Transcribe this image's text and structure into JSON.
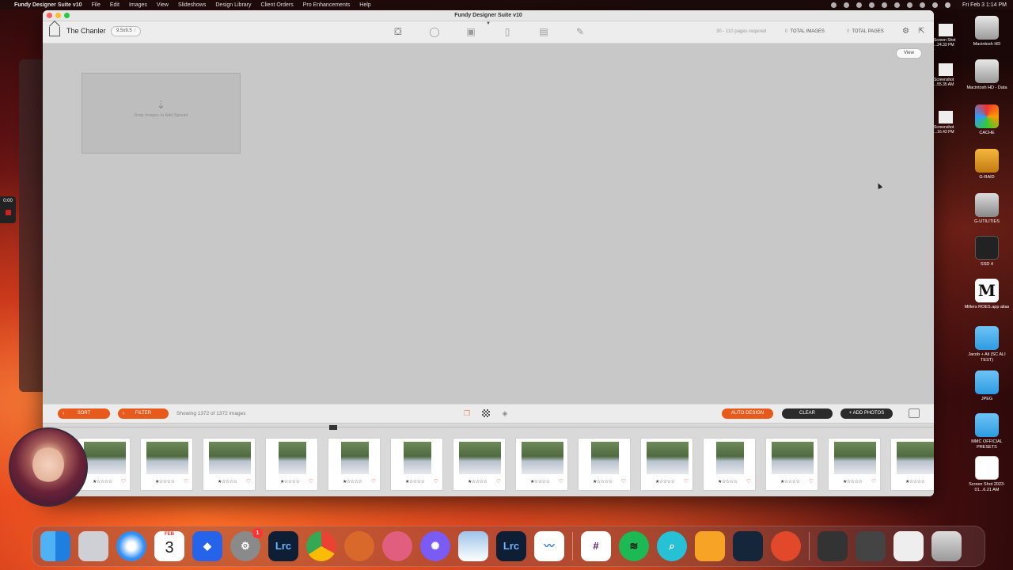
{
  "menubar": {
    "app_name": "Fundy Designer Suite v10",
    "items": [
      "File",
      "Edit",
      "Images",
      "View",
      "Slideshows",
      "Design Library",
      "Client Orders",
      "Pro Enhancements",
      "Help"
    ],
    "clock": "Fri Feb 3  1:14 PM"
  },
  "window": {
    "title": "Fundy Designer Suite v10"
  },
  "toolbar": {
    "album_name": "The Chanler",
    "size": "9.5x9.5",
    "pages_required": "30 - 110 pages required",
    "total_images_count": "0",
    "total_images_label": "TOTAL IMAGES",
    "total_pages_count": "0",
    "total_pages_label": "TOTAL PAGES",
    "mode_icons": [
      "album-design-icon",
      "proof-chat-icon",
      "wall-art-icon",
      "cards-icon",
      "slideshow-icon",
      "retouch-icon"
    ]
  },
  "canvas": {
    "view_label": "View",
    "drop_text": "Drop Images to Add Spread"
  },
  "bottombar": {
    "sort_label": "SORT",
    "filter_label": "FILTER",
    "showing_text": "Showing 1372 of 1372 images",
    "auto_design_label": "AUTO DESIGN",
    "clear_label": "CLEAR",
    "add_photos_label": "+ ADD PHOTOS",
    "colors": {
      "orange": "#e85a1c",
      "dark": "#2b2b2b"
    }
  },
  "filmstrip": {
    "thumbs": [
      {
        "orientation": "landscape",
        "rating": "★☆☆☆☆"
      },
      {
        "orientation": "landscape",
        "rating": "★☆☆☆☆"
      },
      {
        "orientation": "landscape",
        "rating": "★☆☆☆☆"
      },
      {
        "orientation": "portrait",
        "rating": "★☆☆☆☆"
      },
      {
        "orientation": "portrait",
        "rating": "★☆☆☆☆"
      },
      {
        "orientation": "portrait",
        "rating": "★☆☆☆☆"
      },
      {
        "orientation": "landscape",
        "rating": "★☆☆☆☆"
      },
      {
        "orientation": "landscape",
        "rating": "★☆☆☆☆"
      },
      {
        "orientation": "portrait",
        "rating": "★☆☆☆☆"
      },
      {
        "orientation": "landscape",
        "rating": "★☆☆☆☆"
      },
      {
        "orientation": "portrait",
        "rating": "★☆☆☆☆"
      },
      {
        "orientation": "landscape",
        "rating": "★☆☆☆☆"
      },
      {
        "orientation": "landscape",
        "rating": "★☆☆☆☆"
      },
      {
        "orientation": "landscape",
        "rating": "★☆☆☆☆"
      }
    ]
  },
  "recording": {
    "time": "0:00"
  },
  "desktop": {
    "icons": [
      {
        "label": "Macintosh HD",
        "icon": "hard-drive-icon"
      },
      {
        "label": "Macintosh HD - Data",
        "icon": "hard-drive-icon"
      },
      {
        "label": "CACHE",
        "icon": "cache-drive-icon"
      },
      {
        "label": "G-RAID",
        "icon": "raid-drive-icon"
      },
      {
        "label": "G-UTILITIES",
        "icon": "utilities-drive-icon"
      },
      {
        "label": "SSD 4",
        "icon": "ssd-drive-icon"
      },
      {
        "label": "Millers ROES.app alias",
        "icon": "millers-app-icon"
      },
      {
        "label": "Jacob + Ali (SC ALI TEST)",
        "icon": "folder-icon"
      },
      {
        "label": "JPEG",
        "icon": "folder-icon"
      },
      {
        "label": "MMC OFFICIAL PRESETS",
        "icon": "folder-icon"
      },
      {
        "label": "Screen Shot 2023-01...6.21 AM",
        "icon": "screenshot-icon"
      }
    ],
    "partial_icons": [
      {
        "label": "Screen Shot ...24.33 PM"
      },
      {
        "label": "Screenshot ...55.35 AM"
      },
      {
        "label": "Screenshot ...16.43 PM"
      }
    ]
  },
  "dock": {
    "calendar_month": "FEB",
    "calendar_day": "3",
    "settings_badge": "1",
    "apps": [
      "finder-icon",
      "launchpad-icon",
      "safari-icon",
      "calendar-icon",
      "dropbox-icon",
      "system-settings-icon",
      "lightroom-classic-icon",
      "chrome-icon",
      "fundy-icon",
      "toggl-icon",
      "perplexity-icon",
      "photo-app-icon",
      "lightroom-classic-icon-2",
      "freeform-icon",
      "slack-icon",
      "spotify-icon",
      "search-app-icon",
      "tasks-icon",
      "dashlane-icon",
      "fundy-v10-icon"
    ]
  }
}
